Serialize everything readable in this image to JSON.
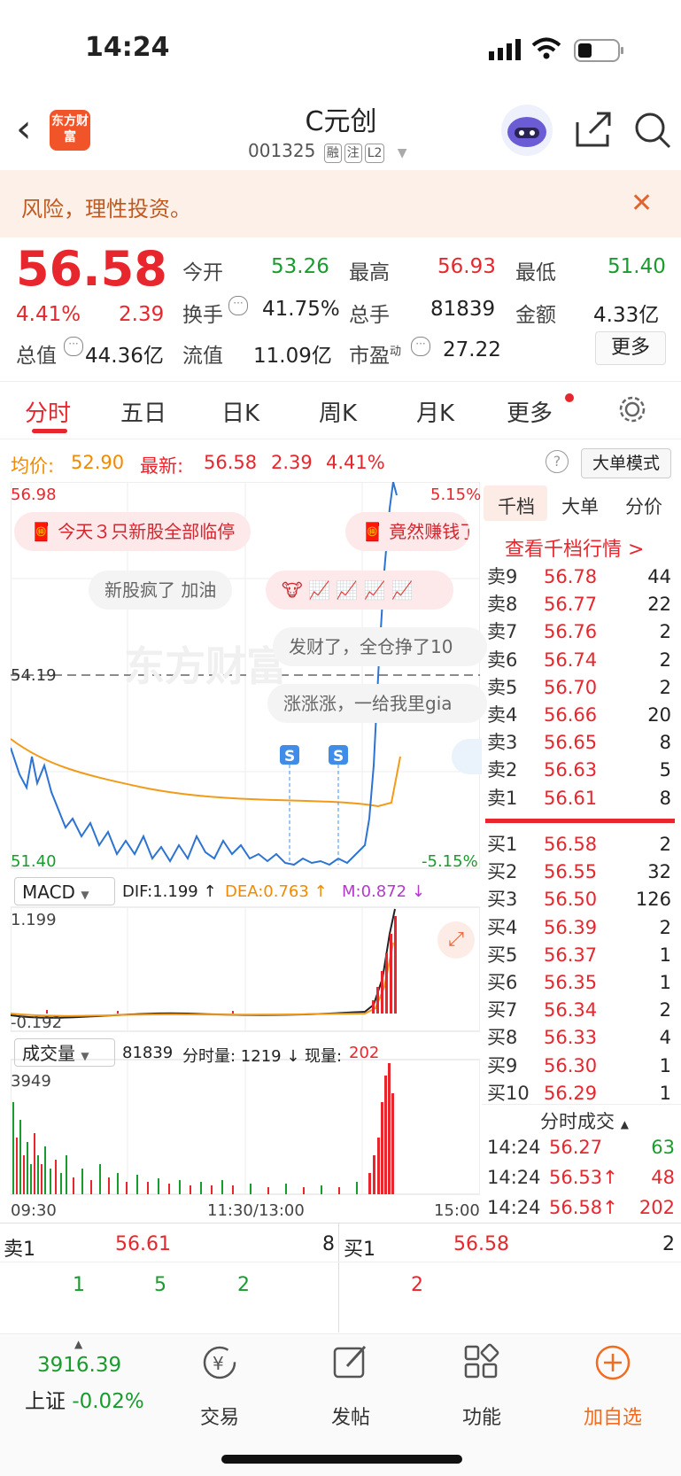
{
  "status": {
    "time": "14:24"
  },
  "header": {
    "title": "C元创",
    "code": "001325",
    "tags": [
      "融",
      "注",
      "L2"
    ],
    "logo_text": "东方财富"
  },
  "banner": {
    "text": "风险，理性投资。"
  },
  "quote": {
    "price": "56.58",
    "pct": "4.41%",
    "chg": "2.39",
    "open_label": "今开",
    "open": "53.26",
    "high_label": "最高",
    "high": "56.93",
    "low_label": "最低",
    "low": "51.40",
    "turnover_label": "换手",
    "turnover": "41.75%",
    "volume_label": "总手",
    "volume": "81839",
    "amount_label": "金额",
    "amount": "4.33亿",
    "mcap_label": "总值",
    "mcap": "44.36亿",
    "float_label": "流值",
    "float": "11.09亿",
    "pe_label": "市盈",
    "pe_sup": "动",
    "pe": "27.22",
    "more": "更多"
  },
  "tabs": [
    "分时",
    "五日",
    "日K",
    "周K",
    "月K",
    "更多"
  ],
  "info_row": {
    "avg_label": "均价:",
    "avg": "52.90",
    "latest_label": "最新:",
    "latest": "56.58",
    "chg": "2.39",
    "pct": "4.41%",
    "mode": "大单模式"
  },
  "chart": {
    "y_top": "56.98",
    "y_mid": "54.19",
    "y_bot": "51.40",
    "pct_top": "5.15%",
    "pct_bot": "-5.15%",
    "x_start": "09:30",
    "x_mid": "11:30/13:00",
    "x_end": "15:00",
    "bubbles": [
      "今天３只新股全部临停",
      "竟然赚钱了",
      "新股疯了 加油",
      "发财了，全仓挣了10",
      "涨涨涨，一给我里gia"
    ],
    "macd_label": "MACD",
    "dif": "DIF:1.199 ↑",
    "dea": "DEA:0.763 ↑",
    "m": "M:0.872 ↓",
    "macd_top": "1.199",
    "macd_bot": "-0.192",
    "vol_label": "成交量",
    "vol_total": "81839",
    "vol_time": "分时量: 1219 ↓",
    "vol_now_label": "现量:",
    "vol_now": "202",
    "vol_top": "3949"
  },
  "chart_data": {
    "type": "line",
    "x_range": [
      "09:30",
      "15:00"
    ],
    "ylim": [
      51.4,
      56.98
    ],
    "reference": 54.19
  },
  "orderbook": {
    "tabs": [
      "千档",
      "大单",
      "分价"
    ],
    "link": "查看千档行情 >",
    "sells": [
      {
        "label": "卖9",
        "price": "56.78",
        "vol": "44"
      },
      {
        "label": "卖8",
        "price": "56.77",
        "vol": "22"
      },
      {
        "label": "卖7",
        "price": "56.76",
        "vol": "2"
      },
      {
        "label": "卖6",
        "price": "56.74",
        "vol": "2"
      },
      {
        "label": "卖5",
        "price": "56.70",
        "vol": "2"
      },
      {
        "label": "卖4",
        "price": "56.66",
        "vol": "20"
      },
      {
        "label": "卖3",
        "price": "56.65",
        "vol": "8"
      },
      {
        "label": "卖2",
        "price": "56.63",
        "vol": "5"
      },
      {
        "label": "卖1",
        "price": "56.61",
        "vol": "8"
      }
    ],
    "buys": [
      {
        "label": "买1",
        "price": "56.58",
        "vol": "2"
      },
      {
        "label": "买2",
        "price": "56.55",
        "vol": "32"
      },
      {
        "label": "买3",
        "price": "56.50",
        "vol": "126"
      },
      {
        "label": "买4",
        "price": "56.39",
        "vol": "2"
      },
      {
        "label": "买5",
        "price": "56.37",
        "vol": "1"
      },
      {
        "label": "买6",
        "price": "56.35",
        "vol": "1"
      },
      {
        "label": "买7",
        "price": "56.34",
        "vol": "2"
      },
      {
        "label": "买8",
        "price": "56.33",
        "vol": "4"
      },
      {
        "label": "买9",
        "price": "56.30",
        "vol": "1"
      },
      {
        "label": "买10",
        "price": "56.29",
        "vol": "1"
      }
    ],
    "ticks_title": "分时成交",
    "ticks": [
      {
        "t": "14:24",
        "p": "56.27",
        "v": "63"
      },
      {
        "t": "14:24",
        "p": "56.53↑",
        "v": "48"
      },
      {
        "t": "14:24",
        "p": "56.58↑",
        "v": "202"
      }
    ]
  },
  "summary": {
    "sell1_label": "卖1",
    "sell1_price": "56.61",
    "sell1_vol": "8",
    "buy1_label": "买1",
    "buy1_price": "56.58",
    "buy1_vol": "2",
    "sell_queue": [
      "1",
      "5",
      "2"
    ],
    "buy_queue": [
      "2"
    ]
  },
  "bottom": {
    "index_value": "3916.39",
    "index_name": "上证",
    "index_pct": "-0.02%",
    "items": [
      "交易",
      "发帖",
      "功能",
      "加自选"
    ]
  }
}
